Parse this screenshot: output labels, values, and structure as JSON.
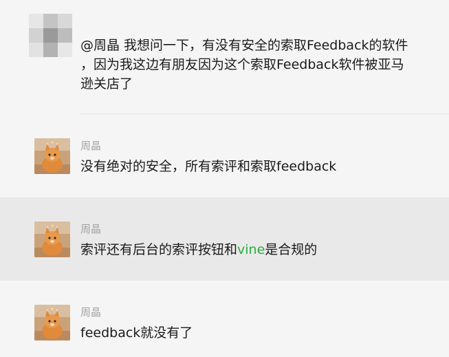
{
  "messages": [
    {
      "sender": "",
      "lines": [
        "@周晶  我想问一下，有没有安全的索取Feedback的软件",
        "，因为我这边有朋友因为这个索取Feedback软件被亚马",
        "逊关店了"
      ]
    },
    {
      "sender": "周晶",
      "text": "没有绝对的安全，所有索评和索取feedback"
    },
    {
      "sender": "周晶",
      "text_before": "索评还有后台的索评按钮和",
      "link": "vine",
      "text_after": "是合规的"
    },
    {
      "sender": "周晶",
      "text": "feedback就没有了"
    }
  ],
  "colors": {
    "background": "#f5f5f5",
    "highlight": "#e9e9e9",
    "sender": "#a3a3a3",
    "text": "#1a1a1a",
    "link": "#2aae3e"
  },
  "icons": {
    "avatar_blurred": "blurred-avatar-icon",
    "avatar_cat": "cat-avatar-icon"
  }
}
